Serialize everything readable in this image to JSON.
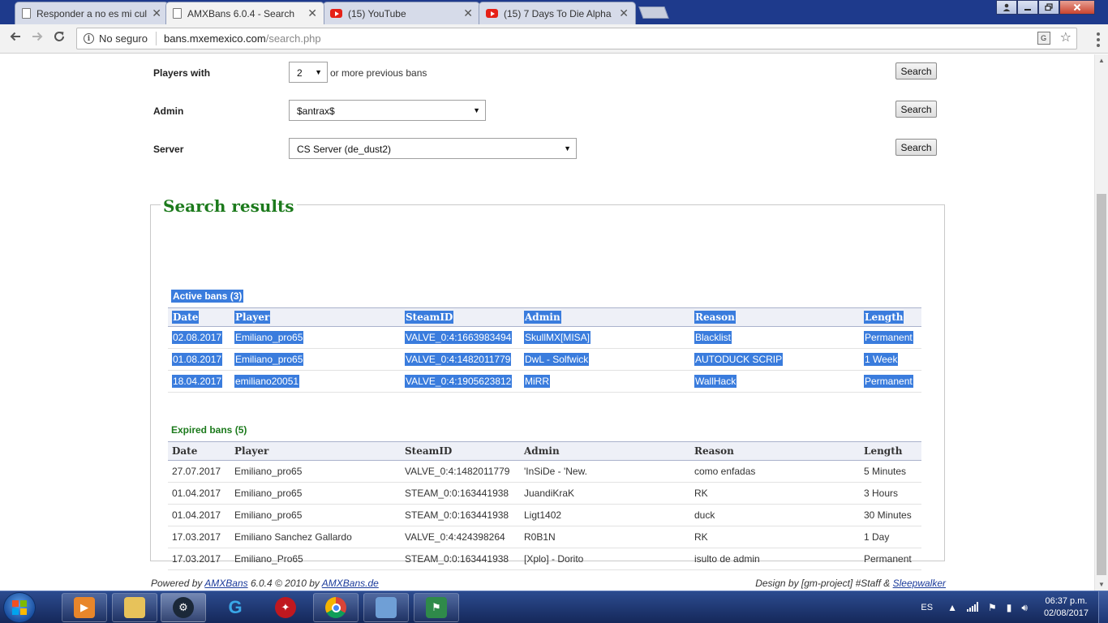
{
  "browser": {
    "tabs": [
      {
        "title": "Responder a no es mi cul",
        "favicon": "document-icon",
        "active": false
      },
      {
        "title": "AMXBans 6.0.4 - Search",
        "favicon": "document-icon",
        "active": true
      },
      {
        "title": "(15) YouTube",
        "favicon": "youtube-icon",
        "active": false
      },
      {
        "title": "(15) 7 Days To Die Alpha",
        "favicon": "youtube-icon",
        "active": false
      }
    ],
    "tab_close_glyph": "✕",
    "security_label": "No seguro",
    "url_host": "bans.mxemexico.com",
    "url_path": "/search.php"
  },
  "filters": {
    "players_with": {
      "label": "Players with",
      "value": "2",
      "suffix": "or more previous bans",
      "button": "Search"
    },
    "admin": {
      "label": "Admin",
      "value": "$antrax$",
      "button": "Search"
    },
    "server": {
      "label": "Server",
      "value": "CS Server (de_dust2)",
      "button": "Search"
    }
  },
  "results": {
    "title": "Search results",
    "columns": [
      "Date",
      "Player",
      "SteamID",
      "Admin",
      "Reason",
      "Length"
    ],
    "active": {
      "title": "Active bans (3)",
      "rows": [
        [
          "02.08.2017",
          "Emiliano_pro65",
          "VALVE_0:4:1663983494",
          "SkullMX[MISA]",
          "Blacklist",
          "Permanent"
        ],
        [
          "01.08.2017",
          "Emiliano_pro65",
          "VALVE_0:4:1482011779",
          "DwL - Solfwick",
          "AUTODUCK SCRIP",
          "1 Week"
        ],
        [
          "18.04.2017",
          "emiliano20051",
          "VALVE_0:4:1905623812",
          "MiRR",
          "WallHack",
          "Permanent"
        ]
      ]
    },
    "expired": {
      "title": "Expired bans (5)",
      "rows": [
        [
          "27.07.2017",
          "Emiliano_pro65",
          "VALVE_0:4:1482011779",
          "'InSiDe - 'New.",
          "como enfadas",
          "5 Minutes"
        ],
        [
          "01.04.2017",
          "Emiliano_pro65",
          "STEAM_0:0:163441938",
          "JuandiKraK",
          "RK",
          "3 Hours"
        ],
        [
          "01.04.2017",
          "Emiliano_pro65",
          "STEAM_0:0:163441938",
          "Ligt1402",
          "duck",
          "30 Minutes"
        ],
        [
          "17.03.2017",
          "Emiliano Sanchez Gallardo",
          "VALVE_0:4:424398264",
          "R0B1N",
          "RK",
          "1 Day"
        ],
        [
          "17.03.2017",
          "Emiliano_Pro65",
          "STEAM_0:0:163441938",
          "[Xplo] - Dorito",
          "isulto de admin",
          "Permanent"
        ]
      ]
    }
  },
  "footer": {
    "powered_prefix": "Powered by",
    "amxbans_link": "AMXBans",
    "version_text": "6.0.4 © 2010 by",
    "amxbans_de_link": "AMXBans.de",
    "design_prefix": "Design by [gm-project] #Staff &",
    "design_link": "Sleepwalker"
  },
  "taskbar": {
    "language": "ES",
    "time": "06:37 p.m.",
    "date": "02/08/2017",
    "pinned": [
      "media-player-icon",
      "file-explorer-icon",
      "steam-icon",
      "logitech-icon",
      "app-red-icon",
      "chrome-icon",
      "control-panel-icon",
      "people-icon"
    ]
  },
  "colors": {
    "accent_green": "#1c7a1c",
    "selection_blue": "#3a7cdd",
    "link_blue": "#1b3b9b",
    "taskbar_blue": "#1e3674"
  }
}
